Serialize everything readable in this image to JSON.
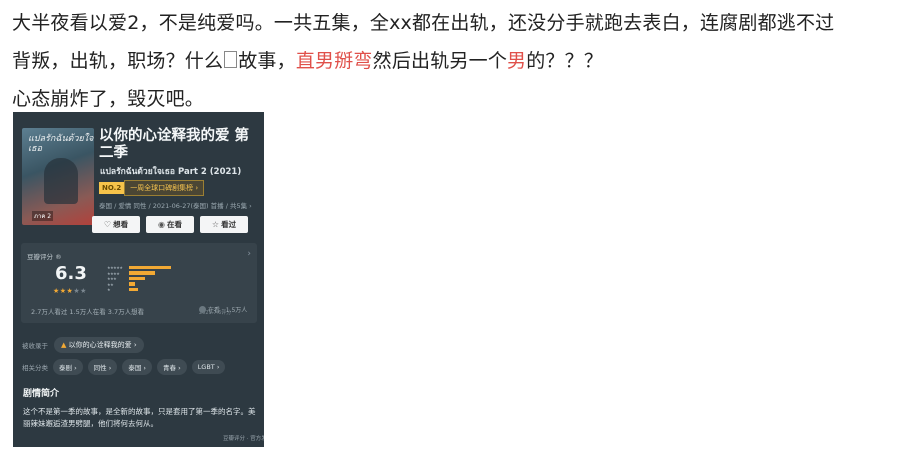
{
  "post": {
    "line1": "大半夜看以爱2，不是纯爱吗。一共五集，全xx都在出轨，还没分手就跑去表白，连腐剧都逃不过",
    "line2_a": "背叛，出轨，职场？什么",
    "line2_b": "故事，",
    "line2_hl1": "直男掰弯",
    "line2_c": "然后出轨另一个",
    "line2_hl2": "男",
    "line2_d": "的？？？",
    "line3": "心态崩炸了，毁灭吧。",
    "highlight_color": "#e0504a"
  },
  "screenshot": {
    "poster_title": "แปลรักฉันด้วยใจเธอ",
    "poster_badge": "ภาค 2",
    "title": "以你的心诠释我的爱 第二季",
    "subtitle": "แปลรักฉันด้วยใจเธอ Part 2 (2021)",
    "rank_no": "NO.2",
    "rank_text": "一周全球口碑剧集榜 ›",
    "meta": "泰国 / 爱情 同性 / 2021-06-27(泰国) 首播 / 共5集 ›",
    "actions": {
      "want": "想看",
      "watching": "在看",
      "watched": "看过"
    },
    "rating": {
      "label": "豆瓣评分 ®",
      "score": "6.3",
      "stars_filled": "★★★",
      "stars_empty": "★★",
      "distribution": [
        0.42,
        0.26,
        0.16,
        0.06,
        0.09
      ],
      "date": "2021.7.6评分",
      "stats": "2.7万人看过   1.5万人在看   3.7万人想看",
      "watch_label": "在看 · 1.5万人"
    },
    "collected": {
      "label": "被收录于",
      "chip": "以你的心诠释我的爱 ›"
    },
    "tags": {
      "label": "相关分类",
      "items": [
        "泰剧 ›",
        "同性 ›",
        "泰国 ›",
        "青春 ›",
        "LGBT ›"
      ]
    },
    "synopsis": {
      "heading": "剧情简介",
      "text": "这个不是第一季的故事，是全新的故事，只是套用了第一季的名字。美丽辣妹邂逅渣男劈腿，他们将何去何从。"
    },
    "watermark": "豆瓣评分 · 官方发布"
  }
}
